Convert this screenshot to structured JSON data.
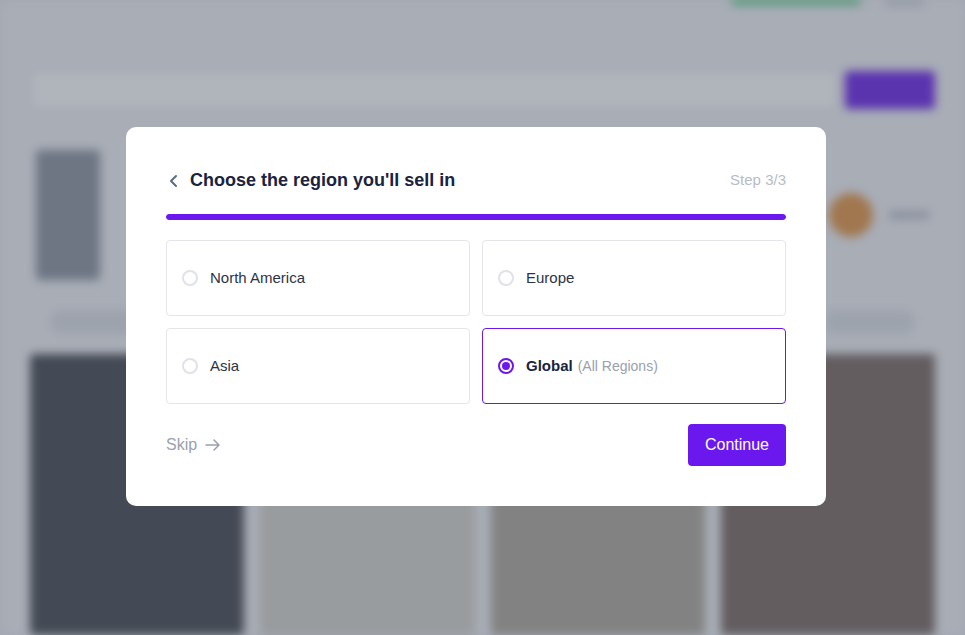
{
  "modal": {
    "title": "Choose the region you'll sell in",
    "step": "Step 3/3",
    "progress": {
      "level": 1
    },
    "options": [
      {
        "label": "North America",
        "selected": false
      },
      {
        "label": "Europe",
        "selected": false
      },
      {
        "label": "Asia",
        "selected": false
      },
      {
        "label": "Global",
        "note": "(All Regions)",
        "selected": true
      }
    ],
    "skip": "Skip",
    "continue": "Continue"
  }
}
